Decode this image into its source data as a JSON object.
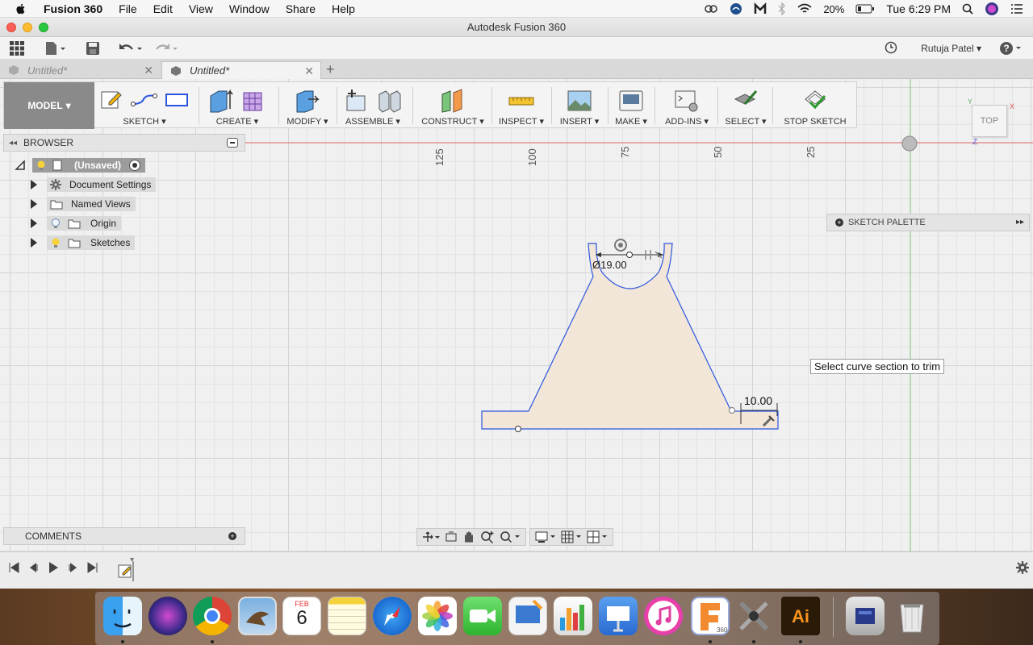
{
  "menubar": {
    "app_name": "Fusion 360",
    "items": [
      "File",
      "Edit",
      "View",
      "Window",
      "Share",
      "Help"
    ],
    "battery": "20%",
    "clock": "Tue 6:29 PM"
  },
  "window": {
    "title": "Autodesk Fusion 360"
  },
  "quick_access": {
    "user": "Rutuja Patel"
  },
  "tabs": [
    {
      "label": "Untitled*",
      "active": false
    },
    {
      "label": "Untitled*",
      "active": true
    }
  ],
  "toolbar": {
    "workspace": "MODEL",
    "groups": [
      "SKETCH",
      "CREATE",
      "MODIFY",
      "ASSEMBLE",
      "CONSTRUCT",
      "INSPECT",
      "INSERT",
      "MAKE",
      "ADD-INS",
      "SELECT",
      "STOP SKETCH"
    ]
  },
  "browser": {
    "title": "BROWSER",
    "root": "(Unsaved)",
    "nodes": [
      "Document Settings",
      "Named Views",
      "Origin",
      "Sketches"
    ]
  },
  "comments": {
    "title": "COMMENTS"
  },
  "sketch_palette": {
    "title": "SKETCH PALETTE"
  },
  "ruler": {
    "ticks": [
      "125",
      "100",
      "75",
      "50",
      "25"
    ]
  },
  "viewcube": {
    "face": "TOP",
    "axis_x": "X",
    "axis_y": "Y",
    "axis_z": "Z"
  },
  "sketch": {
    "dim_diameter": "Ø19.00",
    "dim_linear": "10.00",
    "colors": {
      "profile_fill": "#f0e2d0",
      "line": "#2255dd",
      "axis_red": "#e06666",
      "axis_green": "#66bb66"
    }
  },
  "tooltip": {
    "text": "Select curve section to trim"
  },
  "dock": {
    "calendar_month": "FEB",
    "calendar_day": "6"
  }
}
